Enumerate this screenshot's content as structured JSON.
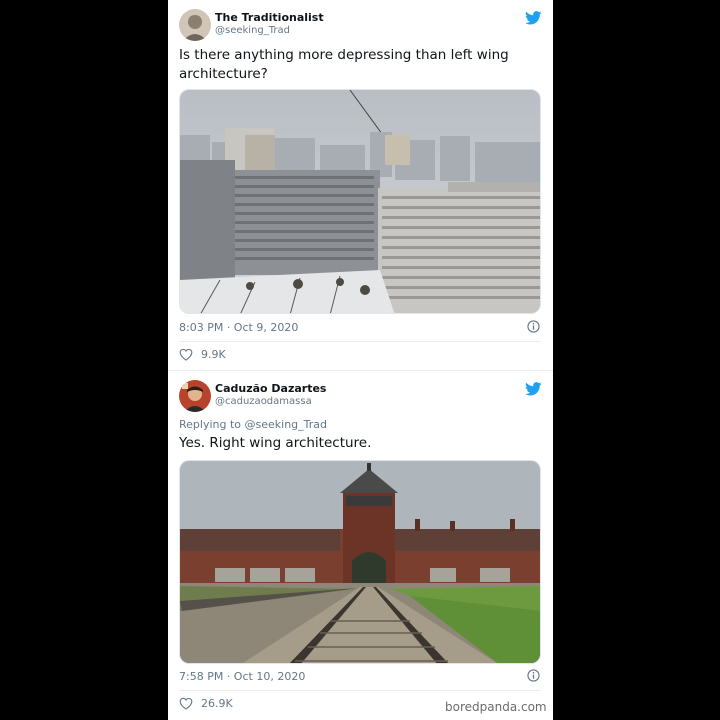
{
  "tweet1": {
    "name": "The Traditionalist",
    "handle": "@seeking_Trad",
    "text": "Is there anything more depressing than left wing architecture?",
    "timestamp": "8:03 PM · Oct 9, 2020",
    "likes": "9.9K",
    "icons": {
      "platform": "twitter-bird-icon",
      "info": "info-icon",
      "like": "heart-icon"
    }
  },
  "tweet2": {
    "name": "Caduzão Dazartes",
    "handle": "@caduzaodamassa",
    "replying_to": "Replying to @seeking_Trad",
    "text": "Yes. Right wing architecture.",
    "timestamp": "7:58 PM · Oct 10, 2020",
    "likes": "26.9K",
    "icons": {
      "platform": "twitter-bird-icon",
      "info": "info-icon",
      "like": "heart-icon"
    }
  },
  "watermark": "boredpanda.com",
  "colors": {
    "twitter_blue": "#1da1f2",
    "secondary_text": "#657786",
    "primary_text": "#0f1419",
    "background": "#000000",
    "card": "#ffffff"
  }
}
